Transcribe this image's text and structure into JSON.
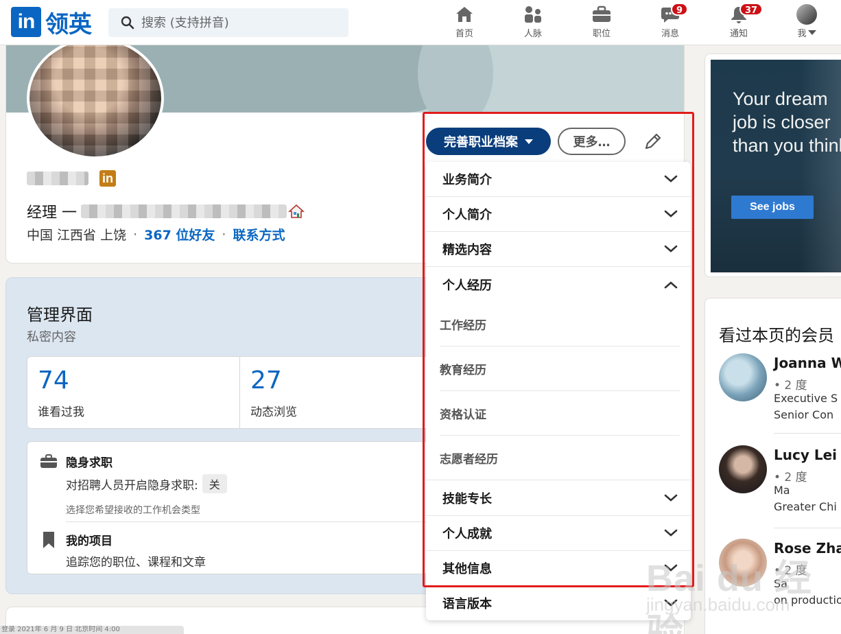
{
  "nav": {
    "logo_in": "in",
    "logo_text": "领英",
    "search_placeholder": "搜索 (支持拼音)",
    "items": [
      {
        "label": "首页",
        "icon": "home-icon"
      },
      {
        "label": "人脉",
        "icon": "network-icon"
      },
      {
        "label": "职位",
        "icon": "briefcase-icon"
      },
      {
        "label": "消息",
        "icon": "message-icon",
        "badge": "9"
      },
      {
        "label": "通知",
        "icon": "bell-icon",
        "badge": "37"
      },
      {
        "label": "我",
        "icon": "avatar"
      }
    ]
  },
  "profile": {
    "name_badge": "in",
    "headline_prefix": "经理 一",
    "location": "中国 江西省 上饶",
    "connections": "367 位好友",
    "contact": "联系方式",
    "dot": "·"
  },
  "actions": {
    "primary": "完善职业档案",
    "more": "更多…"
  },
  "dropdown": {
    "items": [
      {
        "label": "业务简介",
        "state": "collapsed"
      },
      {
        "label": "个人简介",
        "state": "collapsed"
      },
      {
        "label": "精选内容",
        "state": "collapsed"
      },
      {
        "label": "个人经历",
        "state": "expanded"
      },
      {
        "label": "技能专长",
        "state": "collapsed"
      },
      {
        "label": "个人成就",
        "state": "collapsed"
      },
      {
        "label": "其他信息",
        "state": "collapsed"
      },
      {
        "label": "语言版本",
        "state": "collapsed"
      }
    ],
    "subitems": [
      "工作经历",
      "教育经历",
      "资格认证",
      "志愿者经历"
    ]
  },
  "dashboard": {
    "title": "管理界面",
    "subtitle": "私密内容",
    "stats": [
      {
        "value": "74",
        "label": "谁看过我"
      },
      {
        "value": "27",
        "label": "动态浏览"
      }
    ],
    "tools": [
      {
        "title": "隐身求职",
        "desc": "对招聘人员开启隐身求职:",
        "toggle": "关",
        "note": "选择您希望接收的工作机会类型"
      },
      {
        "title": "我的项目",
        "desc": "追踪您的职位、课程和文章"
      }
    ]
  },
  "ad": {
    "text": "Your dream job is closer than you think",
    "button": "See jobs"
  },
  "viewers": {
    "title": "看过本页的会员",
    "people": [
      {
        "name": "Joanna W",
        "degree": "• 2 度",
        "line1": "Executive S",
        "line2": "Senior Con"
      },
      {
        "name": "Lucy Lei",
        "degree": "• 2 度",
        "line1": "Ma",
        "line2": "Greater Chi"
      },
      {
        "name": "Rose Zha",
        "degree": "• 2 度",
        "line1": "Sa",
        "line2": "on productio"
      }
    ]
  },
  "watermark": {
    "main": "Bai du 经验",
    "sub": "jingyan.baidu.com"
  },
  "bottom_strip": "登录 2021年 6 月 9 日 北京时间 4:00"
}
